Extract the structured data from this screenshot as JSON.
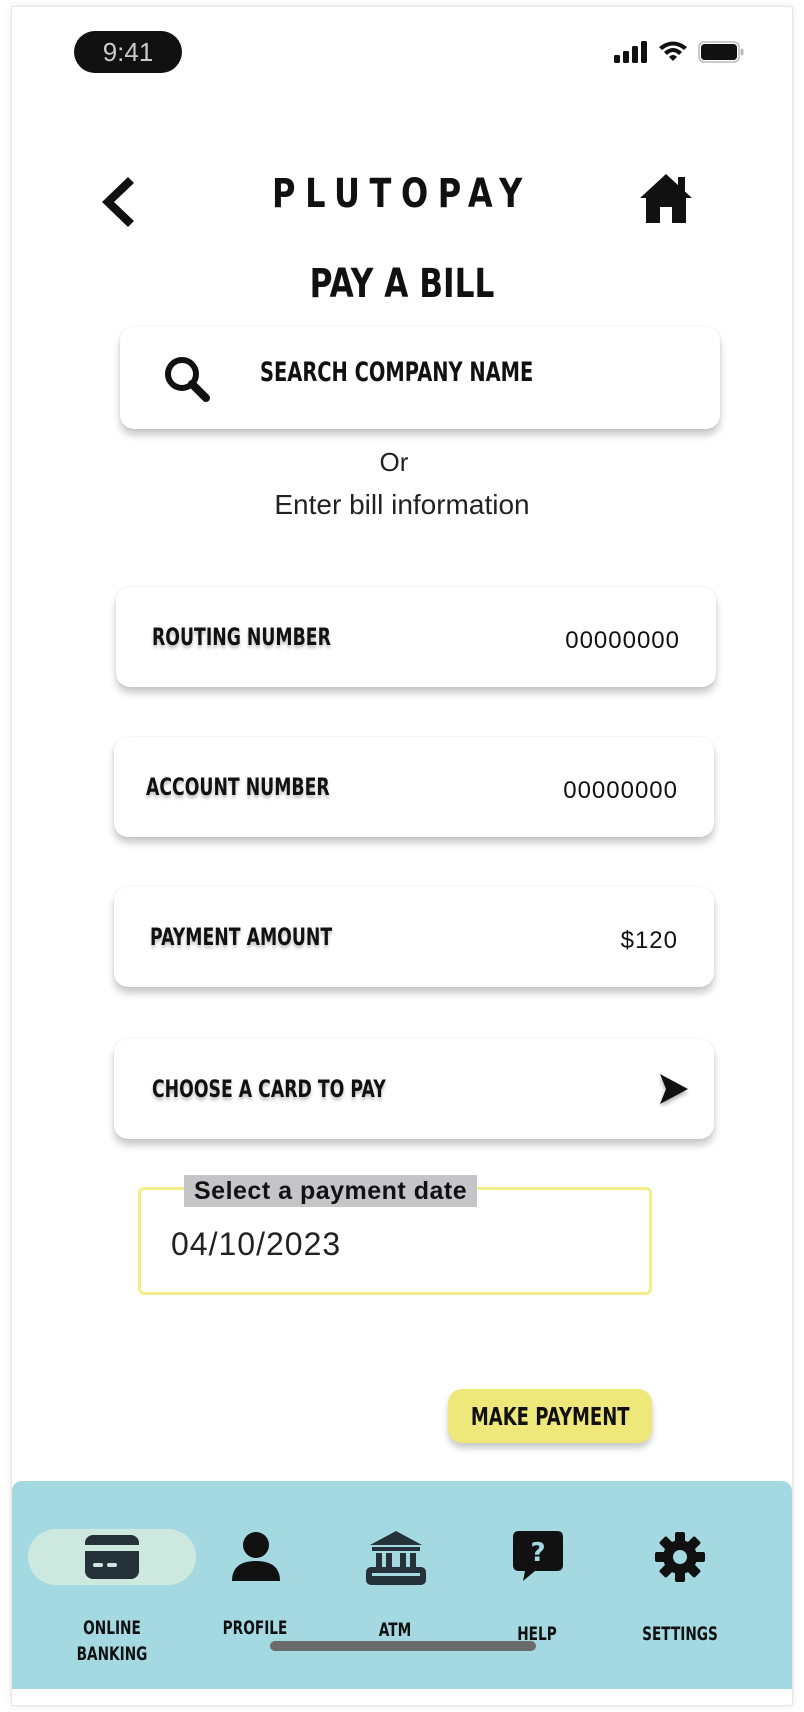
{
  "status_bar": {
    "time": "9:41",
    "icons": [
      "signal-icon",
      "wifi-icon",
      "battery-icon"
    ]
  },
  "header": {
    "brand": "PLUTOPAY",
    "back_icon": "chevron-left-icon",
    "home_icon": "home-icon"
  },
  "page": {
    "title": "PAY A BILL"
  },
  "search": {
    "label": "SEARCH COMPANY NAME",
    "icon": "search-icon"
  },
  "divider_text": {
    "or": "Or",
    "enter": "Enter bill information"
  },
  "fields": {
    "routing": {
      "label": "ROUTING NUMBER",
      "value": "00000000"
    },
    "account": {
      "label": "ACCOUNT NUMBER",
      "value": "00000000"
    },
    "amount": {
      "label": "PAYMENT AMOUNT",
      "value": "$120"
    },
    "card": {
      "label": "CHOOSE A CARD TO PAY",
      "icon": "chevron-right-icon"
    }
  },
  "date_picker": {
    "label": "Select a payment date",
    "value": "04/10/2023"
  },
  "make_payment": {
    "label": "MAKE PAYMENT"
  },
  "bottom_nav": {
    "items": [
      {
        "label": "ONLINE\nBANKING",
        "icon": "credit-card-icon",
        "active": true
      },
      {
        "label": "PROFILE",
        "icon": "user-icon",
        "active": false
      },
      {
        "label": "ATM",
        "icon": "bank-icon",
        "active": false
      },
      {
        "label": "HELP",
        "icon": "help-bubble-icon",
        "active": false
      },
      {
        "label": "SETTINGS",
        "icon": "gear-icon",
        "active": false
      }
    ]
  },
  "colors": {
    "accent_yellow": "#eee87a",
    "date_border": "#f2ee8a",
    "nav_background": "#a4d9e2",
    "nav_active_pill": "#cde9df",
    "date_label_bg": "#c5c5c7"
  }
}
